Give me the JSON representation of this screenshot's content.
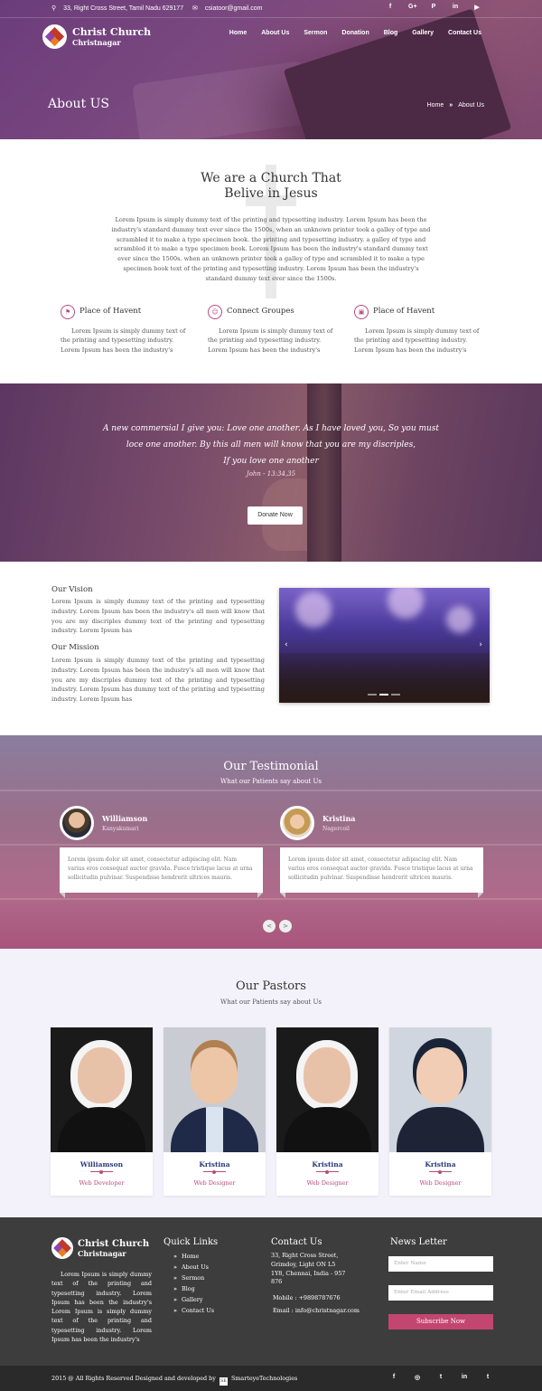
{
  "header": {
    "address": "33, Right Cross Street, Tamil Nadu 629177",
    "email": "csiatoor@gmail.com",
    "social": [
      "f",
      "G+",
      "P",
      "in",
      "▶"
    ],
    "brand_line1": "Christ Church",
    "brand_line2": "Christnagar",
    "nav": [
      "Home",
      "About Us",
      "Sermon",
      "Donation",
      "Blog",
      "Gallery",
      "Contact Us"
    ],
    "page_title": "About US",
    "breadcrumb": [
      "Home",
      "About Us"
    ]
  },
  "about": {
    "title_line1": "We are a Church That",
    "title_line2": "Belive in Jesus",
    "body": "Lorem Ipsum is simply dummy text of the printing and typesetting industry. Lorem Ipsum has been the industry's standard dummy text ever since the 1500s, when an unknown printer took a galley of type and scrambled it to make a type specimen book. the printing and typesetting industry. a galley of type and scrambled it to make a type specimen book. Lorem Ipsum has been the industry's standard dummy text ever since the 1500s. when an unknown printer took a galley of type and scrambled it to make a type specimen book text of the printing and typesetting industry. Lorem Ipsum has been the industry's standard dummy text ever since the 1500s.",
    "features": [
      {
        "icon": "flag-icon",
        "glyph": "⚑",
        "title": "Place of Havent",
        "text": "Lorem Ipsum is simply dummy text of the printing and typesetting industry. Lorem Ipsum has been the industry's"
      },
      {
        "icon": "group-icon",
        "glyph": "☺",
        "title": "Connect Groupes",
        "text": "Lorem Ipsum is simply dummy text of the printing and typesetting industry. Lorem Ipsum has been the industry's"
      },
      {
        "icon": "book-icon",
        "glyph": "▣",
        "title": "Place of Havent",
        "text": "Lorem Ipsum is simply dummy text of the printing and typesetting industry. Lorem Ipsum has been the industry's"
      }
    ]
  },
  "quote": {
    "line1": "A new commersial I give you: Love one another. As I have loved you, So you must",
    "line2": "loce one another. By this all men will know that you are my discriples,",
    "line3": "If you love one another",
    "reference": "John - 13:34,35",
    "button": "Donate Now"
  },
  "vision": {
    "vision_title": "Our Vision",
    "vision_text": "Lorem Ipsum is simply dummy text of the printing and typesetting industry. Lorem Ipsum has been the industry's all men will know that you are my discriples dummy text of the printing and typesetting industry. Lorem Ipsum has",
    "mission_title": "Our Mission",
    "mission_text": "Lorem Ipsum is simply dummy text of the printing and typesetting industry. Lorem Ipsum has been the industry's all men will know that you are my discriples dummy text of the printing and typesetting industry. Lorem Ipsum has dummy text of the printing and typesetting industry. Lorem Ipsum has",
    "slider_prev": "‹",
    "slider_next": "›"
  },
  "testimonial": {
    "title": "Our Testimonial",
    "subtitle": "What our Patients say about Us",
    "people": [
      {
        "name": "Williamson",
        "location": "Kanyakumari",
        "text": "Lorem ipsum dolor sit amet, consectetur adipiscing elit. Nam varius eros consequat auctor gravida. Fusce tristique lacus at urna sollicitudin pulvinar. Suspendisse hendrerit ultrices mauris."
      },
      {
        "name": "Kristina",
        "location": "Nagercoil",
        "text": "Lorem ipsum dolor sit amet, consectetur adipiscing elit. Nam varius eros consequat auctor gravida. Fusce tristique lacus at urna sollicitudin pulvinar. Suspendisse hendrerit ultrices mauris."
      }
    ],
    "prev": "<",
    "next": ">"
  },
  "pastors": {
    "title": "Our Pastors",
    "subtitle": "What our Patients say about Us",
    "cards": [
      {
        "name": "Williamson",
        "role": "Web Developer"
      },
      {
        "name": "Kristina",
        "role": "Web Designer"
      },
      {
        "name": "Kristina",
        "role": "Web Designer"
      },
      {
        "name": "Kristina",
        "role": "Web Designer"
      }
    ]
  },
  "footer": {
    "brand_line1": "Christ Church",
    "brand_line2": "Christnagar",
    "about": "Lorem Ipsum is simply dummy text of the printing and typesetting industry. Lorem Ipsum has been the industry's Lorem Ipsum is simply dummy text of the printing and typesetting industry. Lorem Ipsum has been the industry's",
    "quick_links_title": "Quick Links",
    "quick_links": [
      "Home",
      "About Us",
      "Sermon",
      "Blog",
      "Gallery",
      "Contact Us"
    ],
    "contact_title": "Contact Us",
    "address": "33, Right Cross Street, Grimdoy, Light ON L5 1Y8, Chennai, India - 957 876",
    "mobile": "Mobile : +9898787676",
    "email": "Email : info@christnagar.com",
    "newsletter_title": "News Letter",
    "name_placeholder": "Enter Name",
    "email_placeholder": "Enter Email Address",
    "subscribe": "Subscribe Now"
  },
  "bottom": {
    "copyright_prefix": "2015 @ All Rights Reserved Designed and developed by",
    "dev_badge": "SE",
    "developer": "SmarteyeTechnologies",
    "social": [
      "f",
      "◎",
      "t",
      "in",
      "t"
    ]
  }
}
